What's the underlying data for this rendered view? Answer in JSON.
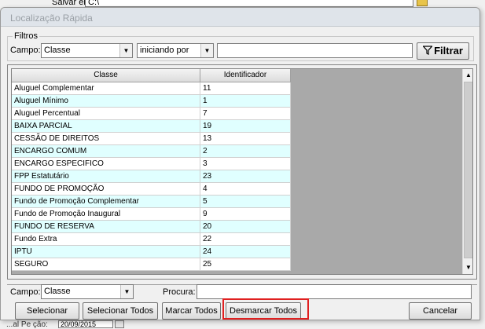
{
  "background": {
    "save_label": "Salvar em:",
    "save_path": "C:\\",
    "bottom_label": "...al Pe ção:",
    "bottom_value": "20/09/2015"
  },
  "dialog": {
    "title": "Localização Rápida",
    "filters": {
      "legend": "Filtros",
      "field_label": "Campo:",
      "field_value": "Classe",
      "operator_value": "iniciando por",
      "search_value": "",
      "filter_button": "Filtrar"
    },
    "grid": {
      "columns": [
        "Classe",
        "Identificador"
      ],
      "rows": [
        [
          "Aluguel Complementar",
          "11"
        ],
        [
          "Aluguel Mínimo",
          "1"
        ],
        [
          "Aluguel Percentual",
          "7"
        ],
        [
          "BAIXA PARCIAL",
          "19"
        ],
        [
          "CESSÃO DE DIREITOS",
          "13"
        ],
        [
          "ENCARGO COMUM",
          "2"
        ],
        [
          "ENCARGO ESPECIFICO",
          "3"
        ],
        [
          "FPP Estatutário",
          "23"
        ],
        [
          "FUNDO DE PROMOÇÃO",
          "4"
        ],
        [
          "Fundo de Promoção Complementar",
          "5"
        ],
        [
          "Fundo de Promoção Inaugural",
          "9"
        ],
        [
          "FUNDO DE RESERVA",
          "20"
        ],
        [
          "Fundo Extra",
          "22"
        ],
        [
          "IPTU",
          "24"
        ],
        [
          "SEGURO",
          "25"
        ]
      ]
    },
    "bottom": {
      "field_label": "Campo:",
      "field_value": "Classe",
      "search_label": "Procura:",
      "search_value": ""
    },
    "buttons": {
      "select": "Selecionar",
      "select_all": "Selecionar Todos",
      "mark_all": "Marcar Todos",
      "unmark_all": "Desmarcar Todos",
      "cancel": "Cancelar"
    },
    "colors": {
      "row_alt": "#e0ffff",
      "highlight": "#e02020"
    }
  }
}
